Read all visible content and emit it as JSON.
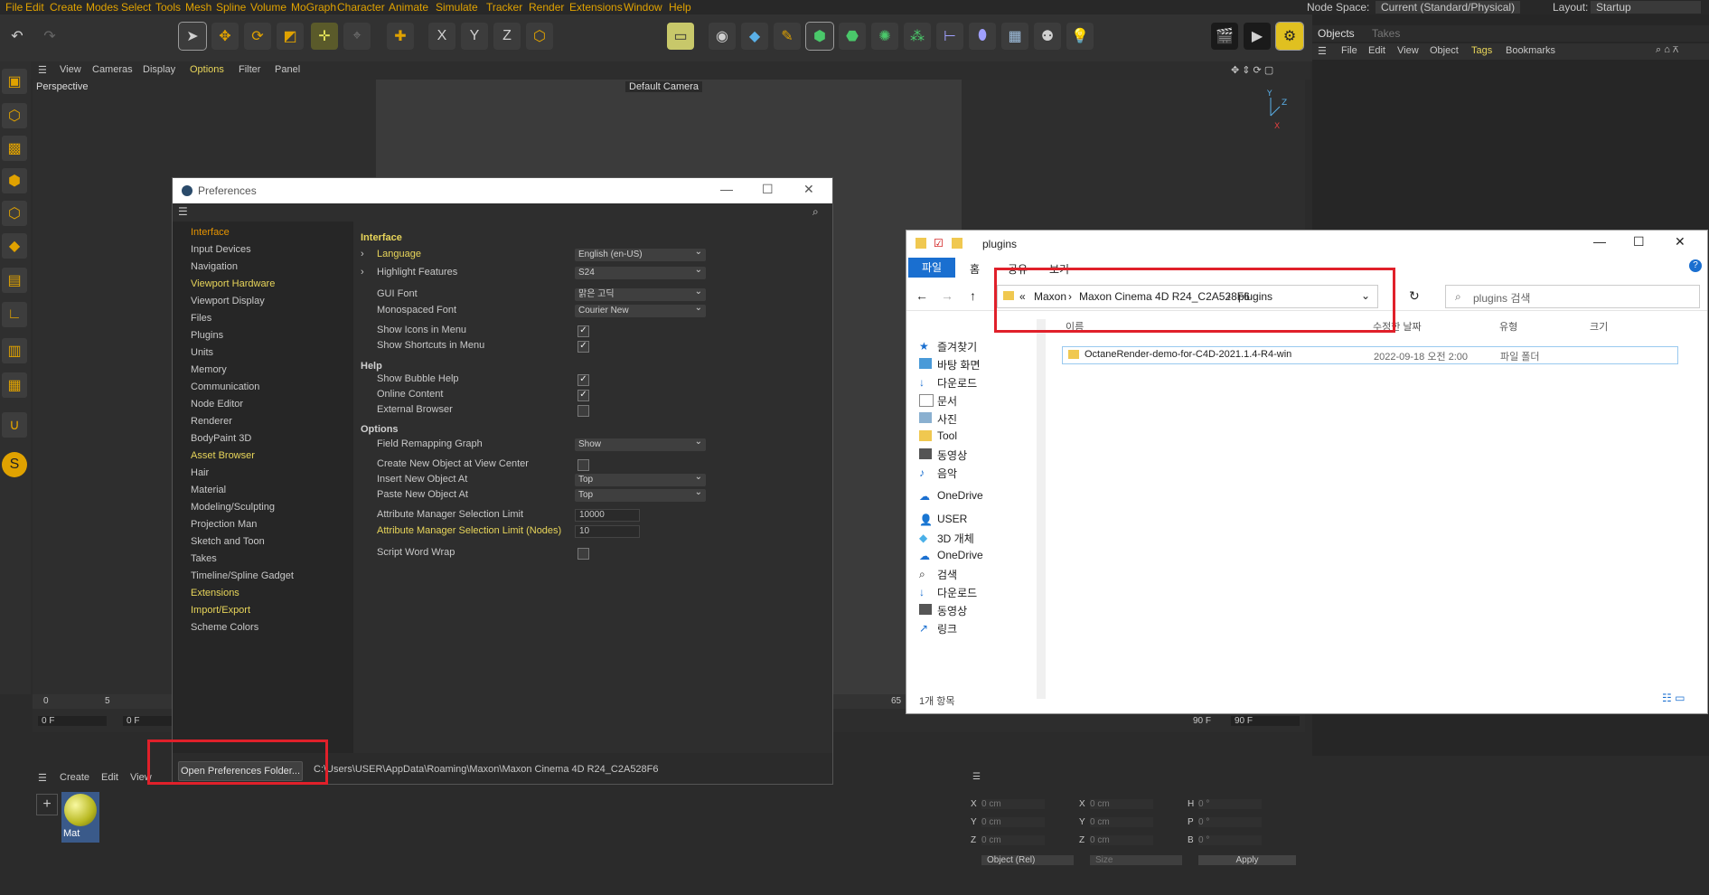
{
  "menubar": {
    "items": [
      "File",
      "Edit",
      "Create",
      "Modes",
      "Select",
      "Tools",
      "Mesh",
      "Spline",
      "Volume",
      "MoGraph",
      "Character",
      "Animate",
      "Simulate",
      "Tracker",
      "Render",
      "Extensions",
      "Window",
      "Help"
    ],
    "node_space_label": "Node Space:",
    "node_space_value": "Current (Standard/Physical)",
    "layout_label": "Layout:",
    "layout_value": "Startup"
  },
  "toolbar": {
    "axis_x": "X",
    "axis_y": "Y",
    "axis_z": "Z"
  },
  "viewport": {
    "menu": [
      "View",
      "Cameras",
      "Display",
      "Options",
      "Filter",
      "Panel"
    ],
    "perspective_label": "Perspective",
    "camera_label": "Default Camera"
  },
  "right_panel": {
    "tab_objects": "Objects",
    "tab_takes": "Takes",
    "menu": [
      "File",
      "Edit",
      "View",
      "Object",
      "Tags",
      "Bookmarks"
    ]
  },
  "preferences": {
    "title": "Preferences",
    "nav": [
      {
        "label": "Interface",
        "style": "o"
      },
      {
        "label": "Input Devices",
        "style": ""
      },
      {
        "label": "Navigation",
        "style": ""
      },
      {
        "label": "Viewport Hardware",
        "style": "y"
      },
      {
        "label": "Viewport Display",
        "style": ""
      },
      {
        "label": "Files",
        "style": ""
      },
      {
        "label": "Plugins",
        "style": ""
      },
      {
        "label": "Units",
        "style": ""
      },
      {
        "label": "Memory",
        "style": ""
      },
      {
        "label": "Communication",
        "style": ""
      },
      {
        "label": "Node Editor",
        "style": ""
      },
      {
        "label": "Renderer",
        "style": ""
      },
      {
        "label": "BodyPaint 3D",
        "style": ""
      },
      {
        "label": "Asset Browser",
        "style": "y"
      },
      {
        "label": "Hair",
        "style": ""
      },
      {
        "label": "Material",
        "style": ""
      },
      {
        "label": "Modeling/Sculpting",
        "style": ""
      },
      {
        "label": "Projection Man",
        "style": ""
      },
      {
        "label": "Sketch and Toon",
        "style": ""
      },
      {
        "label": "Takes",
        "style": ""
      },
      {
        "label": "Timeline/Spline Gadget",
        "style": ""
      },
      {
        "label": "Extensions",
        "style": "y"
      },
      {
        "label": "Import/Export",
        "style": "y"
      },
      {
        "label": "Scheme Colors",
        "style": ""
      }
    ],
    "section_interface": "Interface",
    "language_label": "Language",
    "language_value": "English (en-US)",
    "highlight_label": "Highlight Features",
    "highlight_value": "S24",
    "gui_font_label": "GUI Font",
    "gui_font_value": "맑은 고딕",
    "mono_font_label": "Monospaced Font",
    "mono_font_value": "Courier New",
    "show_icons_label": "Show Icons in Menu",
    "show_shortcuts_label": "Show Shortcuts in Menu",
    "section_help": "Help",
    "bubble_help_label": "Show Bubble Help",
    "online_content_label": "Online Content",
    "external_browser_label": "External Browser",
    "section_options": "Options",
    "field_remap_label": "Field Remapping Graph",
    "field_remap_value": "Show",
    "create_center_label": "Create New Object at View Center",
    "insert_at_label": "Insert New Object At",
    "insert_at_value": "Top",
    "paste_at_label": "Paste New Object At",
    "paste_at_value": "Top",
    "attr_limit_label": "Attribute Manager Selection Limit",
    "attr_limit_value": "10000",
    "attr_limit_nodes_label": "Attribute Manager Selection Limit (Nodes)",
    "attr_limit_nodes_value": "10",
    "script_wrap_label": "Script Word Wrap",
    "open_folder_button": "Open Preferences Folder...",
    "path": "C:\\Users\\USER\\AppData\\Roaming\\Maxon\\Maxon Cinema 4D R24_C2A528F6"
  },
  "explorer": {
    "title": "plugins",
    "ribbon_file": "파일",
    "ribbon_home": "홈",
    "ribbon_share": "공유",
    "ribbon_view": "보기",
    "crumb_sep": "«",
    "crumbs": [
      "Maxon",
      "Maxon Cinema 4D R24_C2A528F6",
      "plugins"
    ],
    "search_placeholder": "plugins 검색",
    "col_name": "이름",
    "col_date": "수정한 날짜",
    "col_type": "유형",
    "col_size": "크기",
    "file_name": "OctaneRender-demo-for-C4D-2021.1.4-R4-win",
    "file_date": "2022-09-18 오전 2:00",
    "file_type": "파일 폴더",
    "nav": [
      "즐겨찾기",
      "바탕 화면",
      "다운로드",
      "문서",
      "사진",
      "Tool",
      "동영상",
      "음악",
      "OneDrive",
      "USER",
      "3D 개체",
      "OneDrive",
      "검색",
      "다운로드",
      "동영상",
      "링크"
    ],
    "status": "1개 항목"
  },
  "timeline": {
    "frame_start": "0 F",
    "frame_cur": "0 F",
    "frame_end": "90 F",
    "frame_end2": "90 F",
    "tick0": "0",
    "tick5": "5",
    "tick65": "65"
  },
  "material_manager": {
    "menu": [
      "Create",
      "Edit",
      "View"
    ],
    "mat_name": "Mat"
  },
  "attributes": {
    "x": "X",
    "y": "Y",
    "z": "Z",
    "h": "H",
    "p": "P",
    "b": "B",
    "pos_val": "0 cm",
    "rot_val": "0 °",
    "mode": "Object (Rel)",
    "size": "Size",
    "apply": "Apply"
  },
  "colors": {
    "accent": "#e0a200",
    "highlight": "#e8d55a",
    "annotation_red": "#e0202a"
  }
}
